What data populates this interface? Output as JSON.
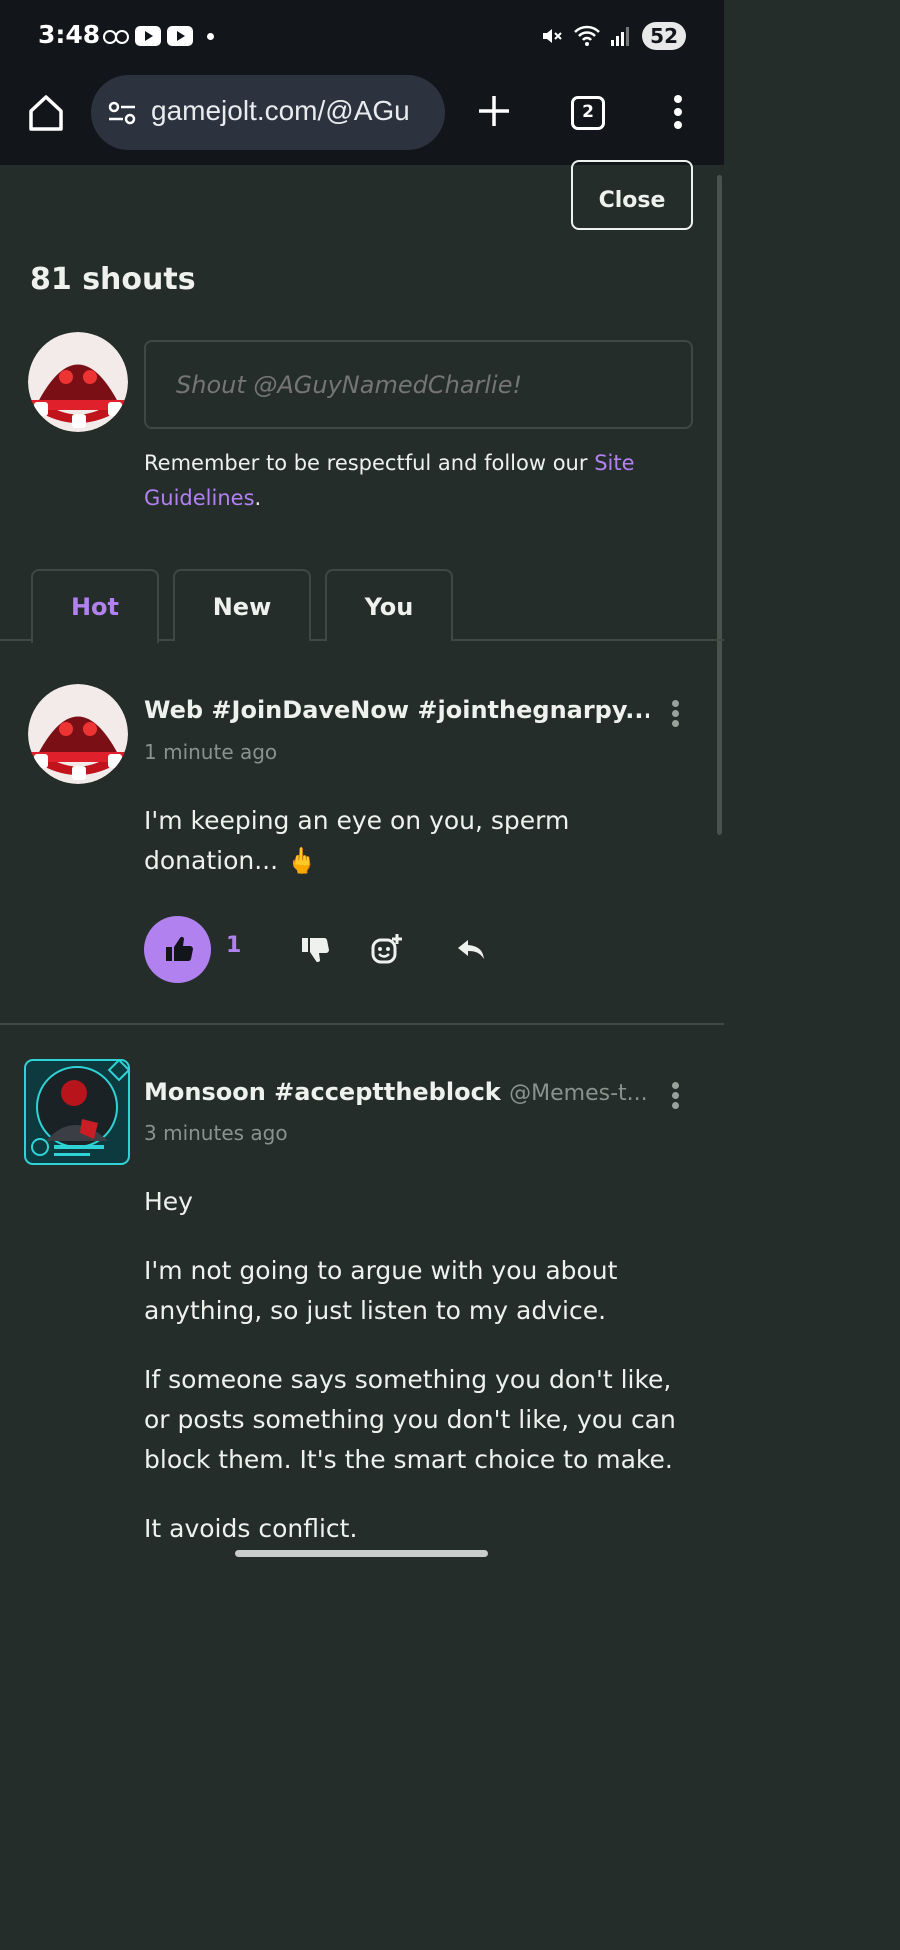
{
  "status_bar": {
    "time": "3:48",
    "battery": "52",
    "icons": [
      "voicemail-icon",
      "youtube-icon",
      "youtube-icon",
      "notification-dot",
      "mute-icon",
      "wifi-icon",
      "signal-icon",
      "battery-icon"
    ]
  },
  "browser": {
    "url": "gamejolt.com/@AGu",
    "tab_count": "2"
  },
  "panel": {
    "close_label": "Close",
    "title": "81 shouts",
    "input_placeholder": "Shout @AGuyNamedCharlie!",
    "guidelines_prefix": "Remember to be respectful and follow our ",
    "guidelines_link": "Site Guidelines",
    "guidelines_suffix": "."
  },
  "tabs": [
    {
      "label": "Hot",
      "active": true
    },
    {
      "label": "New",
      "active": false
    },
    {
      "label": "You",
      "active": false
    }
  ],
  "posts": [
    {
      "author": "Web #JoinDaveNow #jointhegnarpy...",
      "handle": "",
      "time": "1 minute ago",
      "paragraphs": [
        "I'm keeping an eye on you, sperm donation... 🖕"
      ],
      "likes": "1",
      "liked": true
    },
    {
      "author": "Monsoon #accepttheblock",
      "handle": "@Memes-t...",
      "time": "3 minutes ago",
      "paragraphs": [
        "Hey",
        "I'm not going to argue with you about anything, so just listen to my advice.",
        "If someone says something you don't like, or posts something you don't like, you can block them. It's the smart choice to make.",
        "It avoids conflict."
      ]
    }
  ],
  "colors": {
    "background": "#242d2a",
    "accent": "#b281f0",
    "muted": "#8a928e",
    "border": "#3e4944"
  }
}
